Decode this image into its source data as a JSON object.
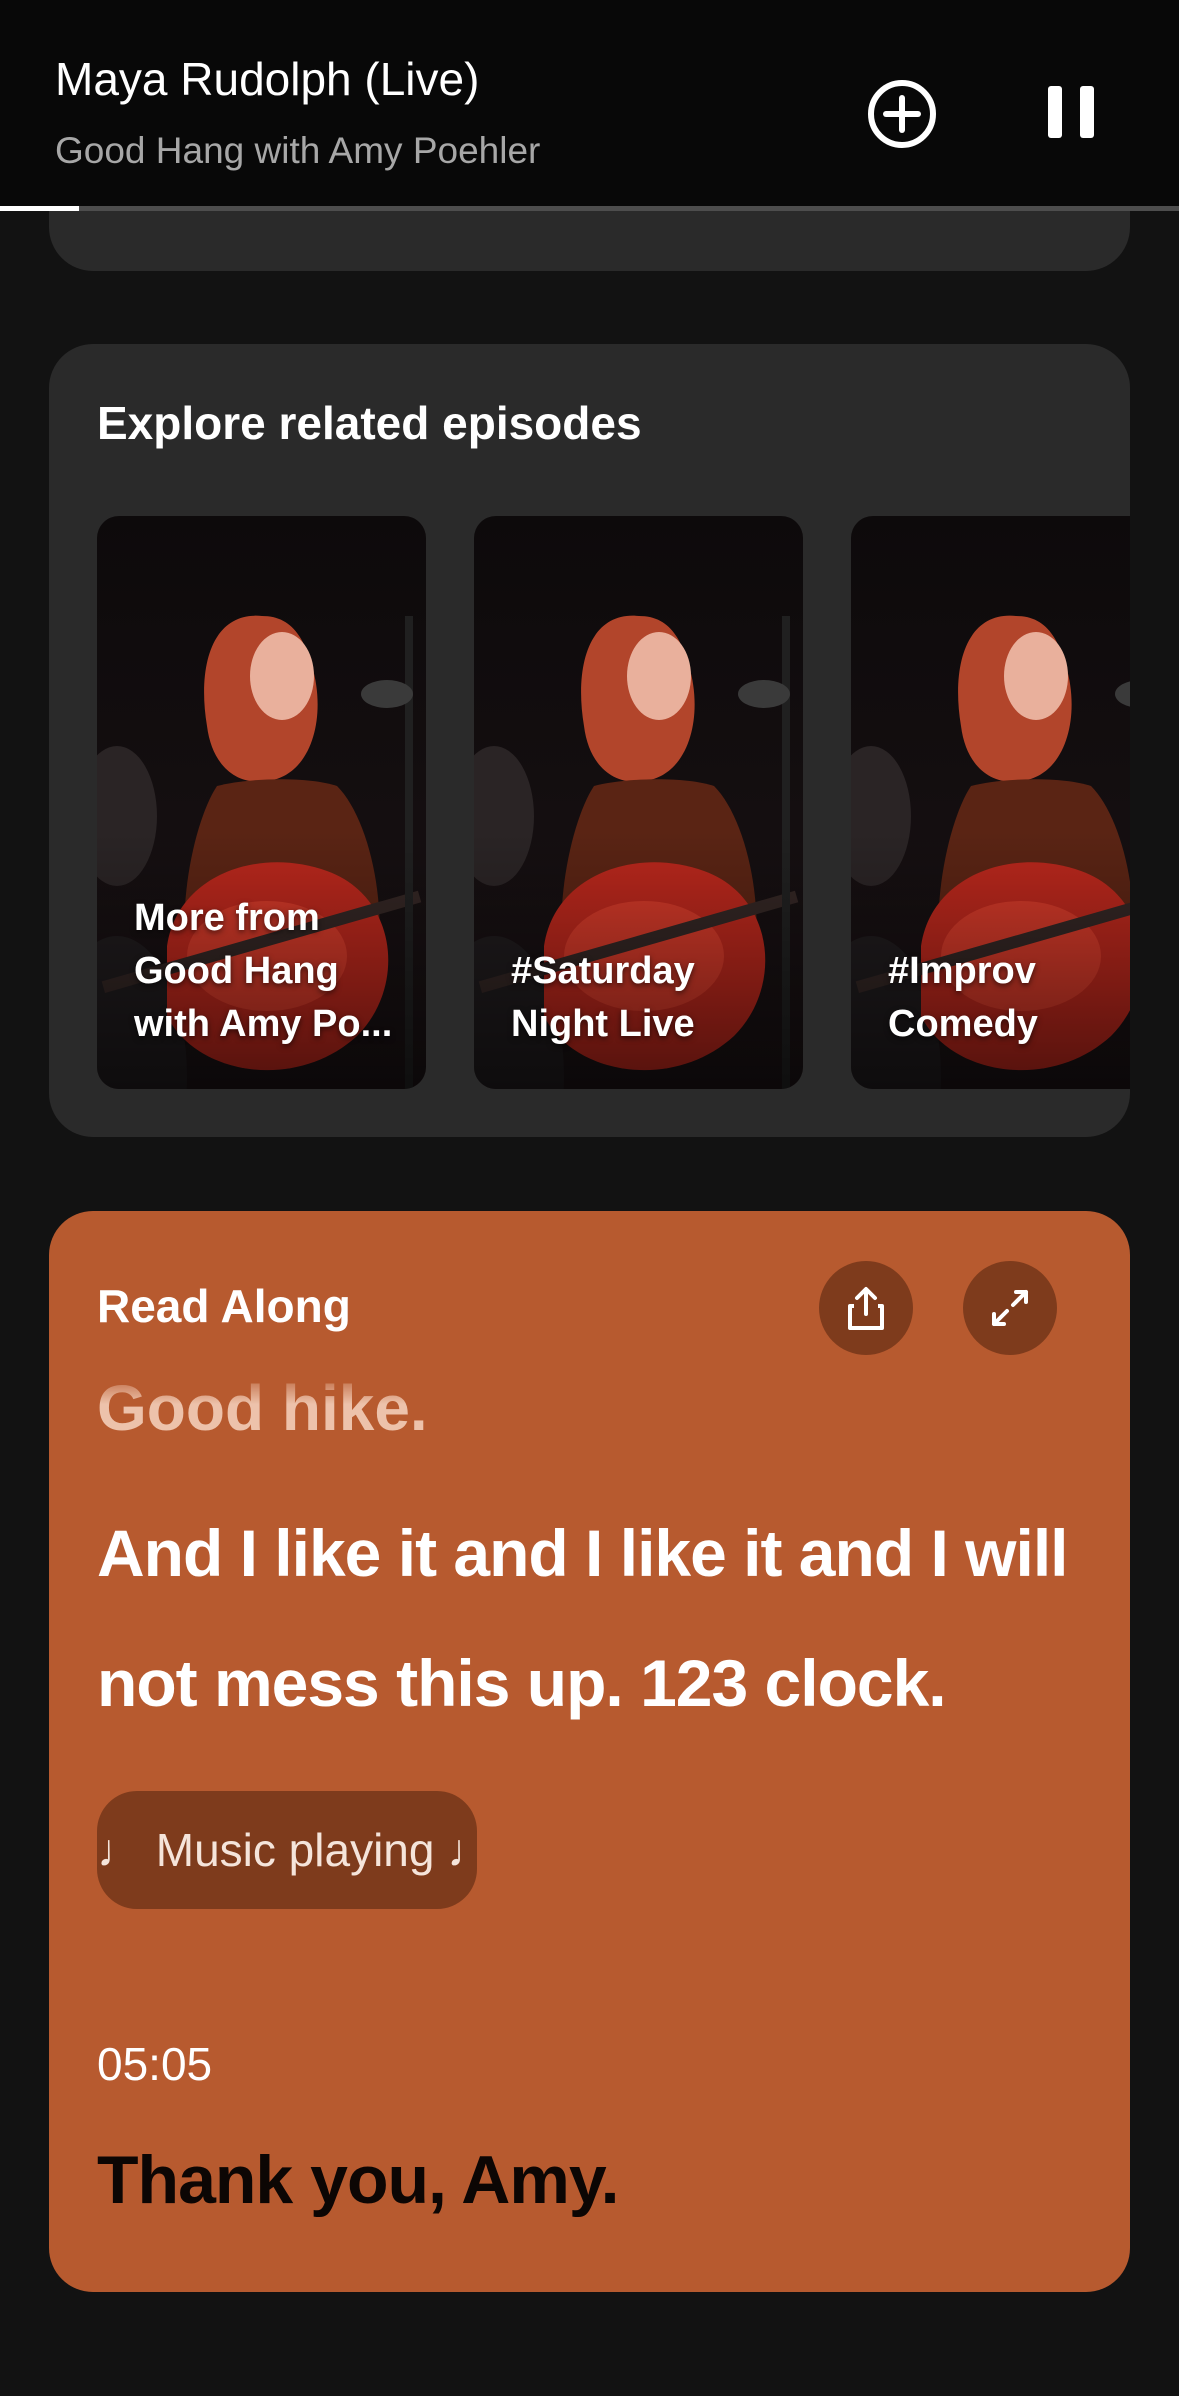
{
  "now_playing": {
    "title": "Maya Rudolph (Live)",
    "show": "Good Hang with Amy Poehler",
    "progress_fraction": 0.067,
    "add_icon": "plus-circle-icon",
    "pause_icon": "pause-icon"
  },
  "explore": {
    "title": "Explore related episodes",
    "tiles": [
      {
        "label": "More from Good Hang with Amy Po..."
      },
      {
        "label": "#Saturday Night Live"
      },
      {
        "label": "#Improv Comedy"
      }
    ]
  },
  "read_along": {
    "title": "Read Along",
    "share_icon": "share-icon",
    "expand_icon": "expand-icon",
    "past_line": "Good hike.",
    "current_line": "And I like it and I like it and I will not mess this up. 123 clock.",
    "music_pill": "♩  Music playing  ♩",
    "timestamp": "05:05",
    "next_line": "Thank you, Amy.",
    "colors": {
      "card": "#b75a2f",
      "button": "#7e3b1c"
    }
  }
}
